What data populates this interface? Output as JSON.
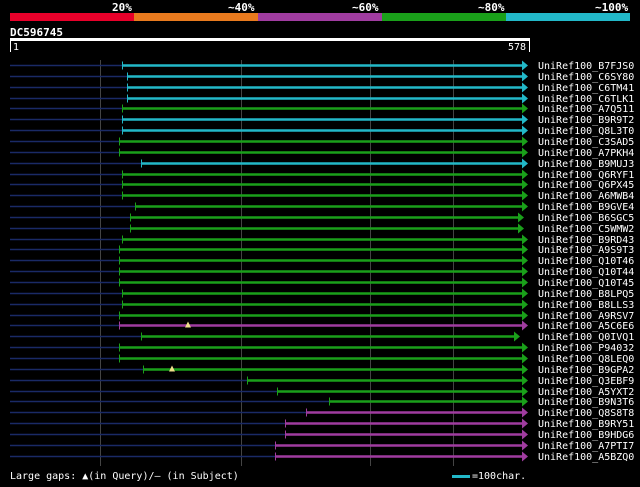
{
  "legend": {
    "labels": [
      "20%",
      "~40%",
      "~60%",
      "~80%",
      "~100%"
    ],
    "colors": [
      "#e8002a",
      "#e87a1e",
      "#a03ca0",
      "#1aa01a",
      "#22b8c8"
    ]
  },
  "query": {
    "name": "DC596745",
    "start": "1",
    "end": "578"
  },
  "hits": [
    {
      "label": "UniRef100_B7FJS0",
      "color": "#22b8c8"
    },
    {
      "label": "UniRef100_C6SY80",
      "color": "#22b8c8"
    },
    {
      "label": "UniRef100_C6TM41",
      "color": "#22b8c8"
    },
    {
      "label": "UniRef100_C6TLK1",
      "color": "#22b8c8"
    },
    {
      "label": "UniRef100_A7Q511",
      "color": "#1aa01a"
    },
    {
      "label": "UniRef100_B9R9T2",
      "color": "#22b8c8"
    },
    {
      "label": "UniRef100_Q8L3T0",
      "color": "#22b8c8"
    },
    {
      "label": "UniRef100_C3SAD5",
      "color": "#1aa01a"
    },
    {
      "label": "UniRef100_A7PKH4",
      "color": "#1aa01a"
    },
    {
      "label": "UniRef100_B9MUJ3",
      "color": "#22b8c8"
    },
    {
      "label": "UniRef100_Q6RYF1",
      "color": "#1aa01a"
    },
    {
      "label": "UniRef100_Q6PX45",
      "color": "#1aa01a"
    },
    {
      "label": "UniRef100_A6MWB4",
      "color": "#1aa01a"
    },
    {
      "label": "UniRef100_B9GVE4",
      "color": "#1aa01a"
    },
    {
      "label": "UniRef100_B6SGC5",
      "color": "#1aa01a"
    },
    {
      "label": "UniRef100_C5WMW2",
      "color": "#1aa01a"
    },
    {
      "label": "UniRef100_B9RD43",
      "color": "#1aa01a"
    },
    {
      "label": "UniRef100_A9S9T3",
      "color": "#1aa01a"
    },
    {
      "label": "UniRef100_Q10T46",
      "color": "#1aa01a"
    },
    {
      "label": "UniRef100_Q10T44",
      "color": "#1aa01a"
    },
    {
      "label": "UniRef100_Q10T45",
      "color": "#1aa01a"
    },
    {
      "label": "UniRef100_B8LPQ5",
      "color": "#1aa01a"
    },
    {
      "label": "UniRef100_B8LLS3",
      "color": "#1aa01a"
    },
    {
      "label": "UniRef100_A9RSV7",
      "color": "#1aa01a"
    },
    {
      "label": "UniRef100_A5C6E6",
      "color": "#a03ca0"
    },
    {
      "label": "UniRef100_Q0IVQ1",
      "color": "#1aa01a"
    },
    {
      "label": "UniRef100_P94032",
      "color": "#1aa01a"
    },
    {
      "label": "UniRef100_Q8LEQ0",
      "color": "#1aa01a"
    },
    {
      "label": "UniRef100_B9GPA2",
      "color": "#1aa01a"
    },
    {
      "label": "UniRef100_Q3EBF9",
      "color": "#1aa01a"
    },
    {
      "label": "UniRef100_A5YXT2",
      "color": "#1aa01a"
    },
    {
      "label": "UniRef100_B9N3T6",
      "color": "#1aa01a"
    },
    {
      "label": "UniRef100_Q8S8T8",
      "color": "#a03ca0"
    },
    {
      "label": "UniRef100_B9RY51",
      "color": "#a03ca0"
    },
    {
      "label": "UniRef100_B9HDG6",
      "color": "#a03ca0"
    },
    {
      "label": "UniRef100_A7PTI7",
      "color": "#a03ca0"
    },
    {
      "label": "UniRef100_A5BZQ0",
      "color": "#a03ca0"
    }
  ],
  "footer": {
    "left": "Large gaps: ▲(in Query)/– (in Subject)",
    "right": "=100char."
  }
}
